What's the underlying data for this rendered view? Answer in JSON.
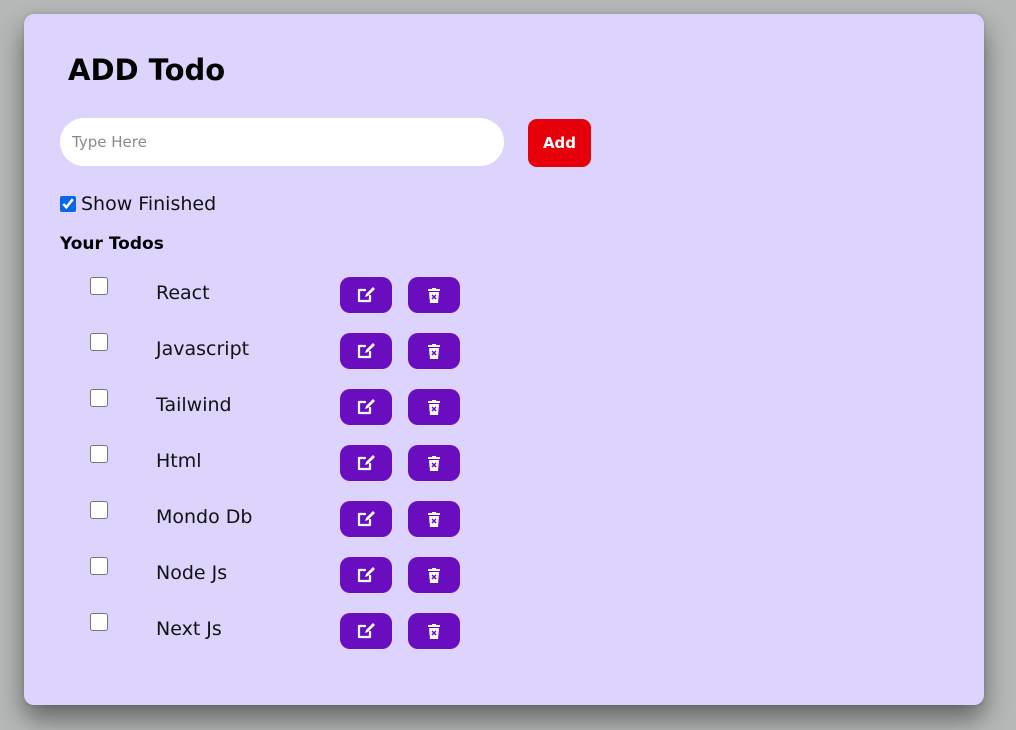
{
  "app": {
    "title": "ADD Todo"
  },
  "input": {
    "placeholder": "Type Here",
    "value": ""
  },
  "add_button": {
    "label": "Add"
  },
  "show_finished": {
    "label": "Show Finished",
    "checked": true
  },
  "list": {
    "heading": "Your Todos",
    "items": [
      {
        "label": "React",
        "done": false
      },
      {
        "label": "Javascript",
        "done": false
      },
      {
        "label": "Tailwind",
        "done": false
      },
      {
        "label": "Html",
        "done": false
      },
      {
        "label": "Mondo Db",
        "done": false
      },
      {
        "label": "Node Js",
        "done": false
      },
      {
        "label": "Next Js",
        "done": false
      }
    ]
  },
  "icons": {
    "edit": "edit-icon",
    "delete": "trash-icon"
  },
  "colors": {
    "background": "#b4b8b7",
    "card": "#dcd4fd",
    "add_button": "#e6000a",
    "action_button": "#6a0dbf",
    "checkbox_accent": "#0a66e8"
  }
}
